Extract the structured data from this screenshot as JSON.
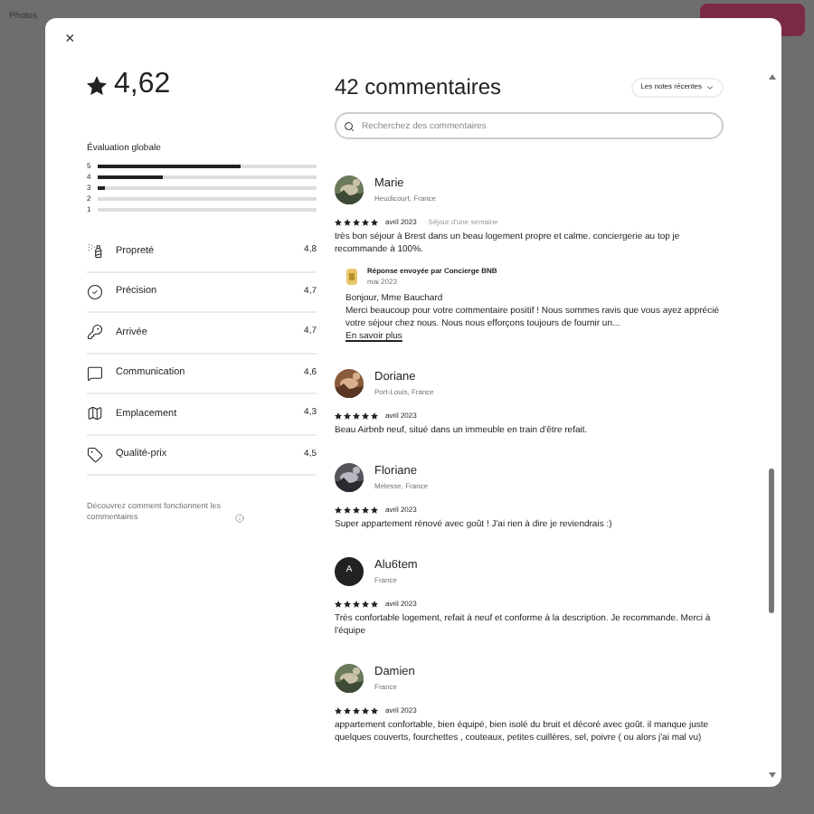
{
  "background": {
    "nav": [
      "Photos"
    ]
  },
  "modal": {
    "close": "×",
    "rating": "4,62",
    "overall": {
      "label": "Évaluation globale",
      "bars": [
        {
          "label": "5",
          "level": 0.65
        },
        {
          "label": "4",
          "level": 0.3
        },
        {
          "label": "3",
          "level": 0.03
        },
        {
          "label": "2"
        },
        {
          "label": "1"
        }
      ]
    },
    "categories": [
      {
        "label": "Propreté",
        "value": "4,8"
      },
      {
        "label": "Précision",
        "value": "4,7"
      },
      {
        "label": "Arrivée",
        "value": "4,7"
      },
      {
        "label": "Communication",
        "value": "4,6"
      },
      {
        "label": "Emplacement",
        "value": "4,3"
      },
      {
        "label": "Qualité-prix",
        "value": "4,5"
      }
    ],
    "footer": "Découvrez comment fonctionnent les commentaires",
    "title": "42 commentaires",
    "sort": "Les notes récentes",
    "search": {
      "placeholder": "Recherchez des commentaires"
    },
    "reviews": [
      {
        "name": "Marie",
        "place": "Heudicourt, France",
        "stars": 5,
        "date": "avril 2023",
        "stay": "· Séjour d'une semaine",
        "text": "très bon séjour à Brest dans un beau logement propre et calme. conciergerie au top je recommande à 100%.",
        "response": {
          "title": "Réponse envoyée par Concierge BNB",
          "date": "mai 2023",
          "greeting": "Bonjour, Mme Bauchard",
          "text": "Merci beaucoup pour votre commentaire positif ! Nous sommes ravis que vous ayez apprécié votre séjour chez nous. Nous nous efforçons toujours de fournir un...",
          "more": "En savoir plus"
        }
      },
      {
        "name": "Doriane",
        "place": "Port-Louis, France",
        "stars": 5,
        "date": "avril 2023",
        "text": "Beau Airbnb neuf, situé dans un immeuble en train d'être refait."
      },
      {
        "name": "Floriane",
        "place": "Melesse, France",
        "stars": 5,
        "date": "avril 2023",
        "text": "Super appartement rénové avec goût ! J'ai rien à dire je reviendrais :)"
      },
      {
        "name": "Alu6tem",
        "place": "France",
        "avatar": {
          "kind": "initial",
          "text": "A"
        },
        "stars": 5,
        "date": "avril 2023",
        "text": "Très confortable logement, refait à neuf et conforme à la description. Je recommande. Merci à l'équipe"
      },
      {
        "name": "Damien",
        "place": "France",
        "stars": 5,
        "date": "avril 2023",
        "text": "appartement confortable, bien équipé, bien isolé du bruit et décoré avec goût. il manque juste quelques couverts, fourchettes , couteaux, petites cuillères, sel, poivre ( ou alors j'ai mal vu)"
      }
    ]
  }
}
